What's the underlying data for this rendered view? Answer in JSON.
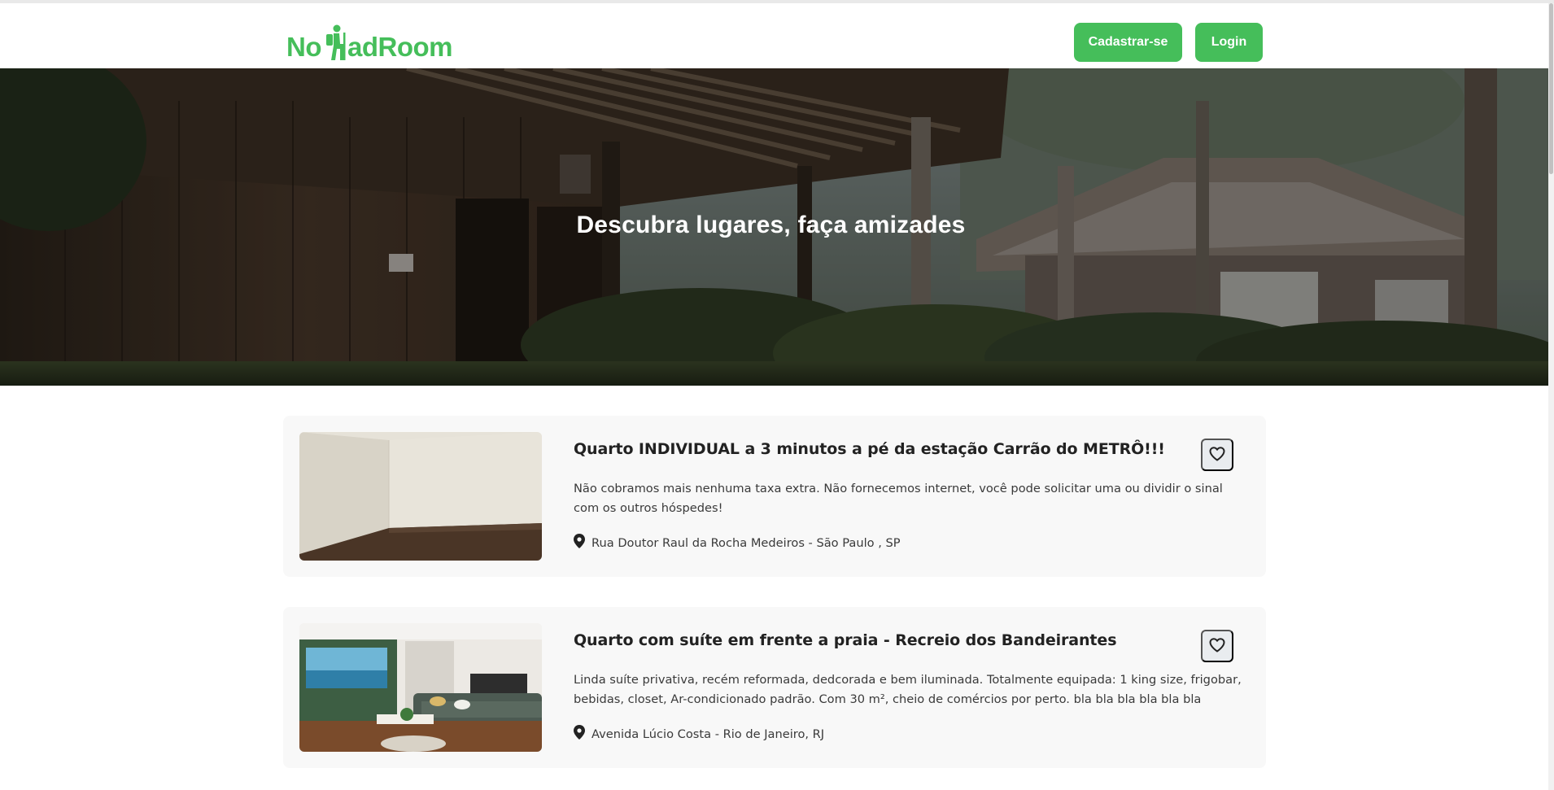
{
  "brand": {
    "logo_prefix": "No",
    "logo_suffix": "adRoom",
    "logo_icon": "hiker-icon",
    "accent": "#45be5a"
  },
  "nav": {
    "signup_label": "Cadastrar-se",
    "login_label": "Login"
  },
  "hero": {
    "title": "Descubra lugares, faça amizades"
  },
  "listings": [
    {
      "title": "Quarto INDIVIDUAL a 3 minutos a pé da estação Carrão do METRÔ!!!",
      "description": "Não cobramos mais nenhuma taxa extra. Não fornecemos internet, você pode solicitar uma ou dividir o sinal com os outros hóspedes!",
      "location": "Rua Doutor Raul da Rocha Medeiros - São Paulo , SP",
      "location_icon": "map-pin-icon",
      "favorite_icon": "heart-icon"
    },
    {
      "title": "Quarto com suíte em frente a praia - Recreio dos Bandeirantes",
      "description": "Linda suíte privativa, recém reformada, dedcorada e bem iluminada. Totalmente equipada: 1 king size, frigobar, bebidas, closet, Ar-condicionado padrão. Com 30 m², cheio de comércios por perto. bla bla bla bla bla bla",
      "location": "Avenida Lúcio Costa - Rio de Janeiro, RJ",
      "location_icon": "map-pin-icon",
      "favorite_icon": "heart-icon"
    }
  ]
}
